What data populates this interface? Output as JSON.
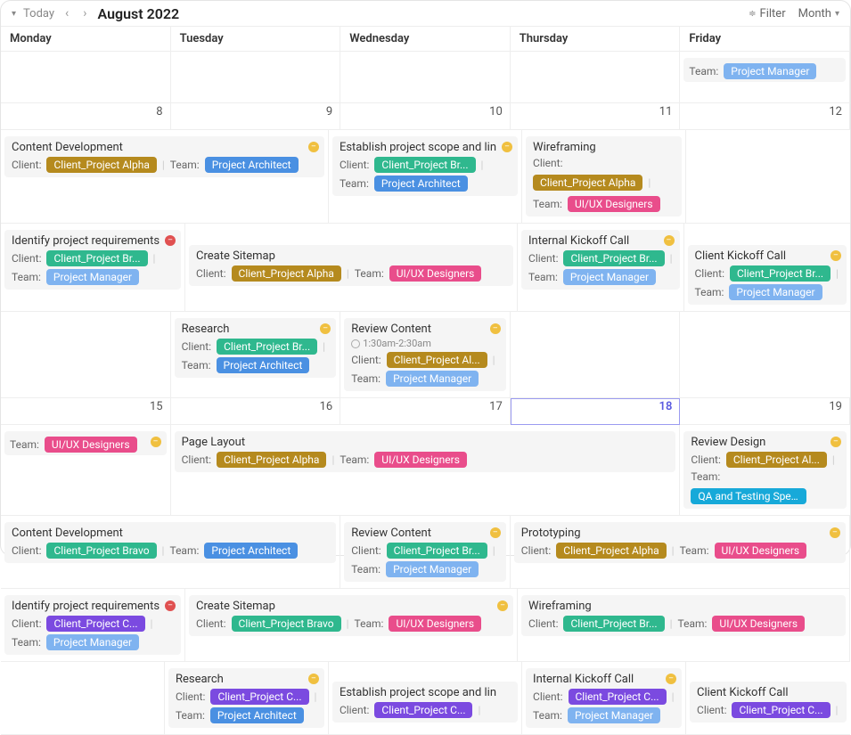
{
  "toolbar": {
    "today": "Today",
    "prev": "‹",
    "next": "›",
    "month_title": "August 2022",
    "filter": "Filter",
    "view": "Month"
  },
  "days": {
    "mon": "Monday",
    "tue": "Tuesday",
    "wed": "Wednesday",
    "thu": "Thursday",
    "fri": "Friday"
  },
  "dates": {
    "d8": "8",
    "d9": "9",
    "d10": "10",
    "d11": "11",
    "d12": "12",
    "d15": "15",
    "d16": "16",
    "d17": "17",
    "d18": "18",
    "d19": "19"
  },
  "labels": {
    "client": "Client:",
    "team": "Team:"
  },
  "clients": {
    "alpha": "Client_Project Alpha",
    "alpha_short": "Client_Project Al...",
    "bravo": "Client_Project Bravo",
    "bravo_short": "Client_Project Br...",
    "charlie": "Client_Project C..."
  },
  "teams": {
    "architect": "Project Architect",
    "manager": "Project Manager",
    "uiux": "UI/UX Designers",
    "qa": "QA and Testing Special"
  },
  "events": {
    "content_dev": "Content Development",
    "identify_req": "Identify project requirements",
    "create_sitemap": "Create Sitemap",
    "research": "Research",
    "establish_scope": "Establish project scope and lin",
    "review_content": "Review Content",
    "review_time": "1:30am-2:30am",
    "wireframing": "Wireframing",
    "internal_kickoff": "Internal Kickoff Call",
    "client_kickoff": "Client Kickoff Call",
    "team_only": "Team:",
    "page_layout": "Page Layout",
    "review_design": "Review Design",
    "prototyping": "Prototyping"
  }
}
